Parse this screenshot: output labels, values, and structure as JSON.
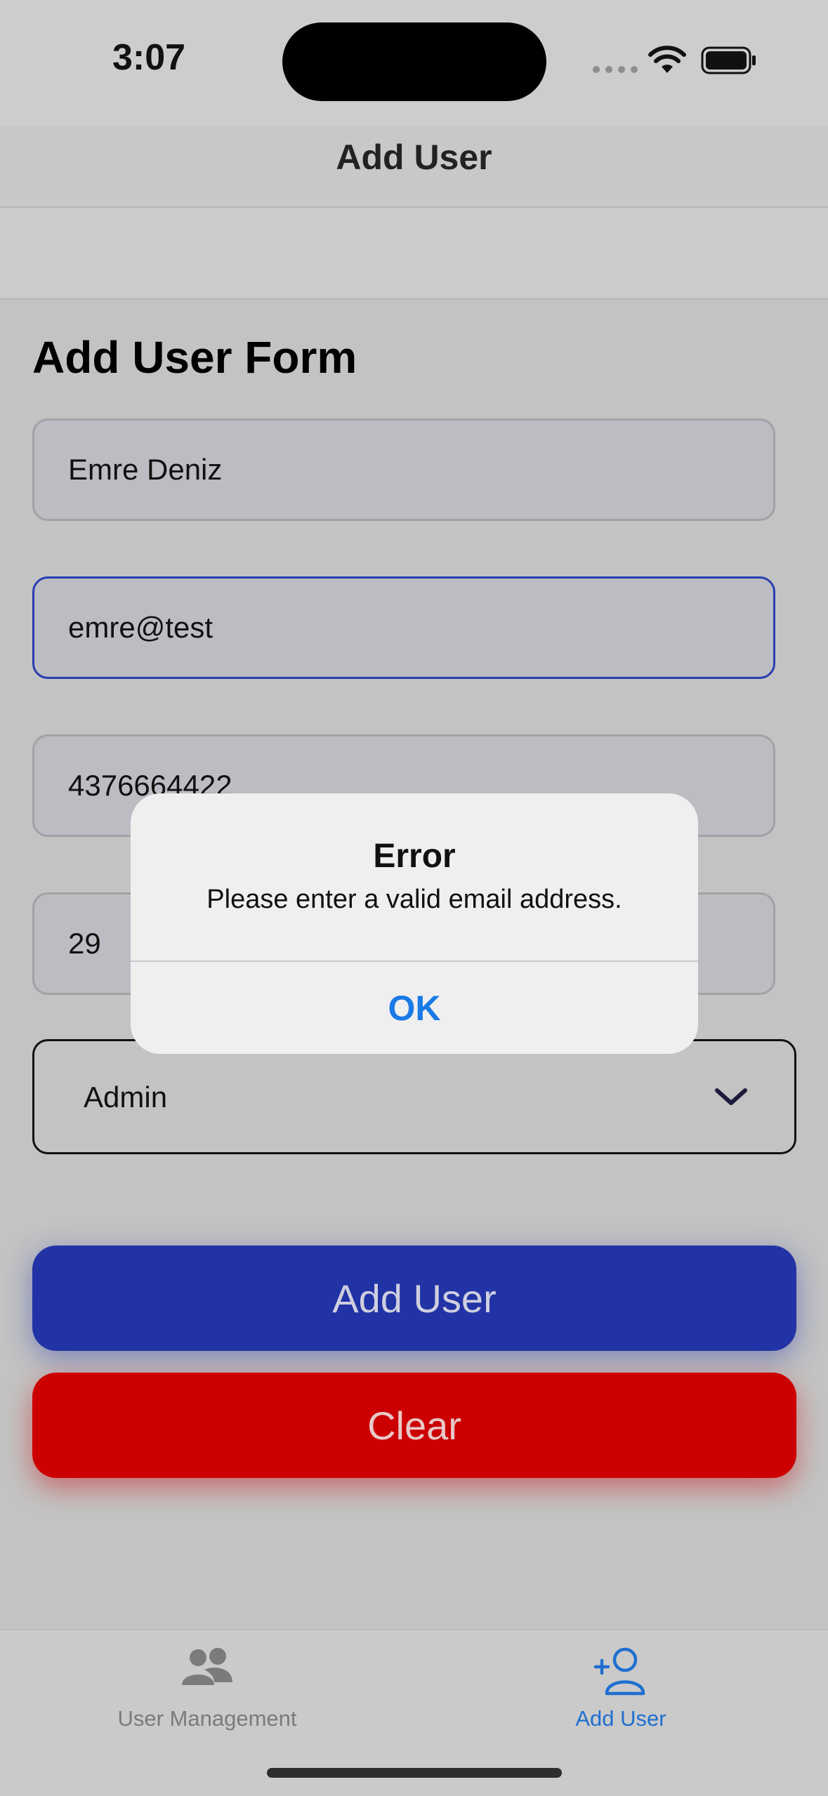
{
  "status_bar": {
    "time": "3:07"
  },
  "nav": {
    "title": "Add User"
  },
  "form": {
    "title": "Add User Form",
    "name_value": "Emre Deniz",
    "email_value": "emre@test",
    "phone_value": "4376664422",
    "age_value": "29",
    "role_value": "Admin",
    "add_button_label": "Add User",
    "clear_button_label": "Clear"
  },
  "alert": {
    "title": "Error",
    "message": "Please enter a valid email address.",
    "ok_label": "OK"
  },
  "tab_bar": {
    "tabs": [
      {
        "label": "User Management",
        "icon": "people-icon",
        "selected": false
      },
      {
        "label": "Add User",
        "icon": "person-add-icon",
        "selected": true
      }
    ]
  },
  "colors": {
    "accent_blue": "#1a7ae6",
    "add_button": "#2233a6",
    "clear_button": "#cc0000",
    "focused_border": "#2a3db0"
  }
}
